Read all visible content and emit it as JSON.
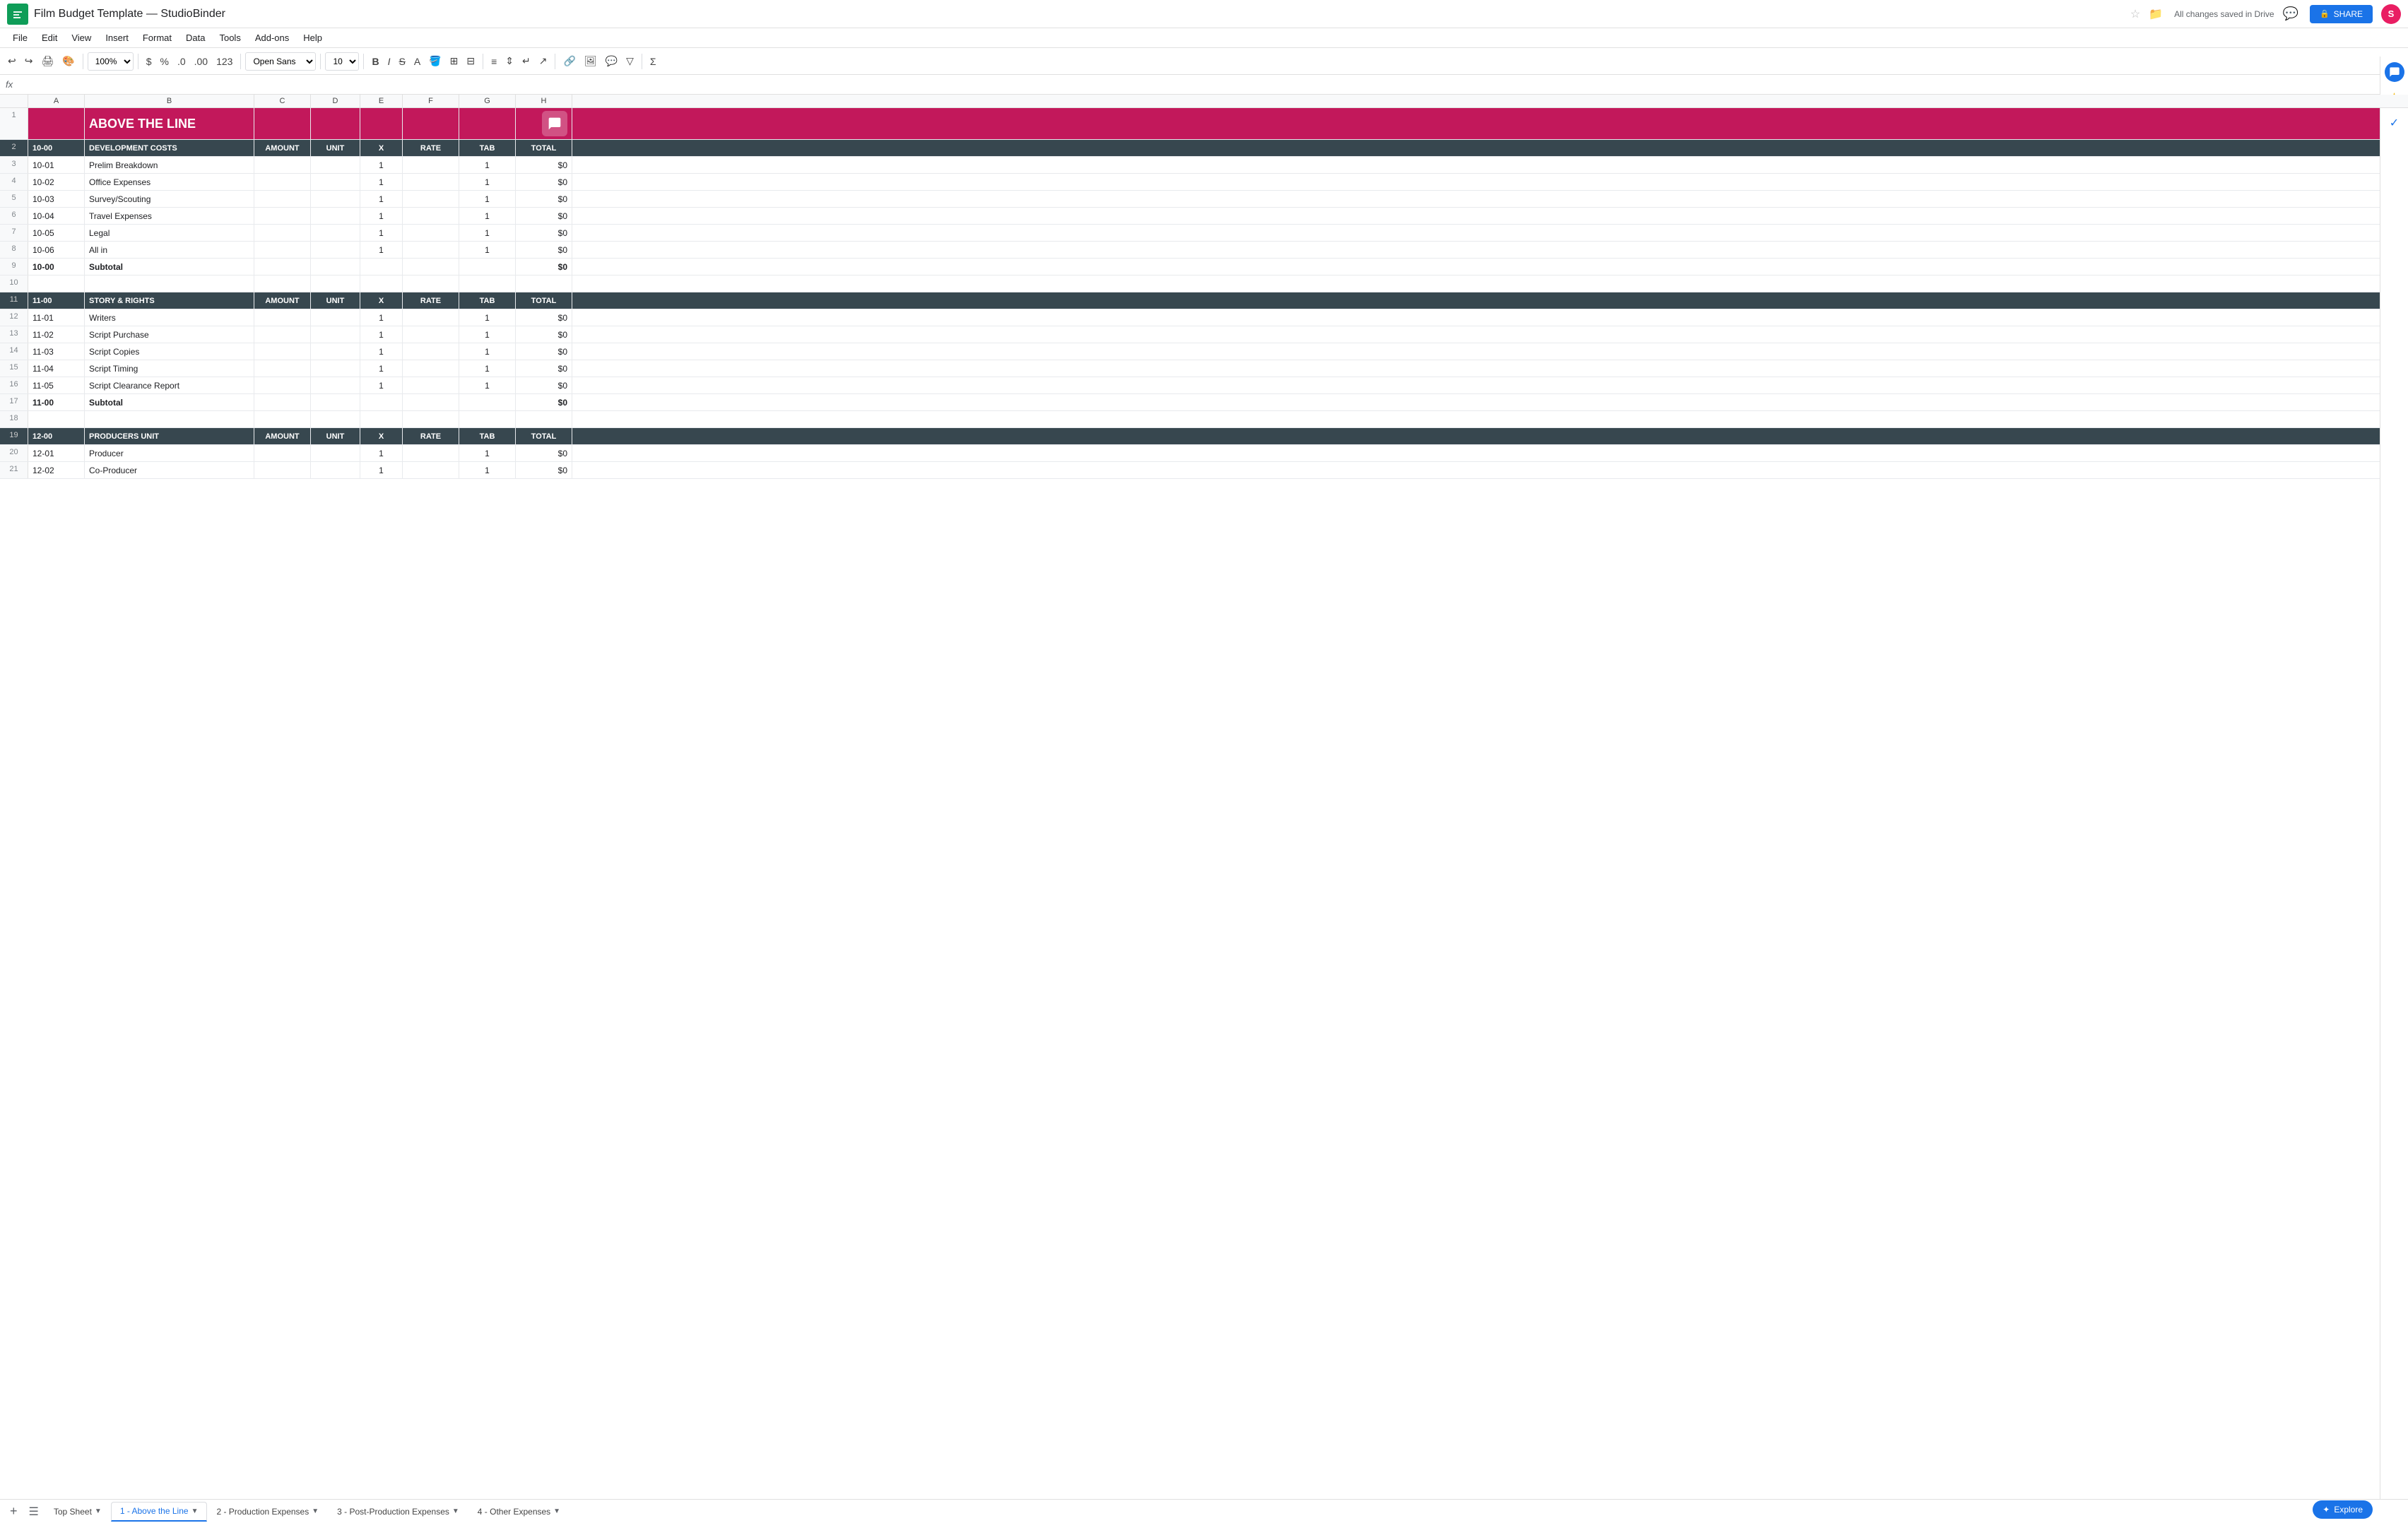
{
  "app": {
    "logo_letter": "S",
    "title": "Film Budget Template — StudioBinder",
    "saved_notice": "All changes saved in Drive"
  },
  "menubar": {
    "items": [
      "File",
      "Edit",
      "View",
      "Insert",
      "Format",
      "Data",
      "Tools",
      "Add-ons",
      "Help"
    ]
  },
  "toolbar": {
    "zoom": "100%",
    "font": "Open Sans",
    "font_size": "10"
  },
  "formulabar": {
    "fx": "fx"
  },
  "tabs": [
    {
      "label": "Top Sheet",
      "active": false
    },
    {
      "label": "1 - Above the Line",
      "active": true
    },
    {
      "label": "2 - Production Expenses",
      "active": false
    },
    {
      "label": "3 - Post-Production Expenses",
      "active": false
    },
    {
      "label": "4 - Other Expenses",
      "active": false
    }
  ],
  "col_headers": [
    "A",
    "B",
    "C",
    "D",
    "E",
    "F",
    "G",
    "H"
  ],
  "title_row": {
    "text": "ABOVE THE LINE",
    "bg": "#c2185b"
  },
  "sections": [
    {
      "row_num": 2,
      "code": "10-00",
      "name": "DEVELOPMENT COSTS",
      "cols": [
        "AMOUNT",
        "UNIT",
        "X",
        "RATE",
        "TAB",
        "TOTAL"
      ]
    },
    {
      "row_num": 11,
      "code": "11-00",
      "name": "STORY & RIGHTS",
      "cols": [
        "AMOUNT",
        "UNIT",
        "X",
        "RATE",
        "TAB",
        "TOTAL"
      ]
    },
    {
      "row_num": 19,
      "code": "12-00",
      "name": "PRODUCERS UNIT",
      "cols": [
        "AMOUNT",
        "UNIT",
        "X",
        "RATE",
        "TAB",
        "TOTAL"
      ]
    }
  ],
  "rows": [
    {
      "num": 1,
      "type": "title"
    },
    {
      "num": 2,
      "type": "section-header",
      "section": 0
    },
    {
      "num": 3,
      "type": "data",
      "code": "10-01",
      "name": "Prelim Breakdown",
      "amount": "",
      "unit": "",
      "x": "1",
      "rate": "",
      "tab": "1",
      "total": "$0"
    },
    {
      "num": 4,
      "type": "data",
      "code": "10-02",
      "name": "Office Expenses",
      "amount": "",
      "unit": "",
      "x": "1",
      "rate": "",
      "tab": "1",
      "total": "$0"
    },
    {
      "num": 5,
      "type": "data",
      "code": "10-03",
      "name": "Survey/Scouting",
      "amount": "",
      "unit": "",
      "x": "1",
      "rate": "",
      "tab": "1",
      "total": "$0"
    },
    {
      "num": 6,
      "type": "data",
      "code": "10-04",
      "name": "Travel Expenses",
      "amount": "",
      "unit": "",
      "x": "1",
      "rate": "",
      "tab": "1",
      "total": "$0"
    },
    {
      "num": 7,
      "type": "data",
      "code": "10-05",
      "name": "Legal",
      "amount": "",
      "unit": "",
      "x": "1",
      "rate": "",
      "tab": "1",
      "total": "$0"
    },
    {
      "num": 8,
      "type": "data",
      "code": "10-06",
      "name": "All in",
      "amount": "",
      "unit": "",
      "x": "1",
      "rate": "",
      "tab": "1",
      "total": "$0"
    },
    {
      "num": 9,
      "type": "subtotal",
      "code": "10-00",
      "name": "Subtotal",
      "total": "$0"
    },
    {
      "num": 10,
      "type": "empty"
    },
    {
      "num": 11,
      "type": "section-header",
      "section": 1
    },
    {
      "num": 12,
      "type": "data",
      "code": "11-01",
      "name": "Writers",
      "amount": "",
      "unit": "",
      "x": "1",
      "rate": "",
      "tab": "1",
      "total": "$0"
    },
    {
      "num": 13,
      "type": "data",
      "code": "11-02",
      "name": "Script Purchase",
      "amount": "",
      "unit": "",
      "x": "1",
      "rate": "",
      "tab": "1",
      "total": "$0"
    },
    {
      "num": 14,
      "type": "data",
      "code": "11-03",
      "name": "Script Copies",
      "amount": "",
      "unit": "",
      "x": "1",
      "rate": "",
      "tab": "1",
      "total": "$0"
    },
    {
      "num": 15,
      "type": "data",
      "code": "11-04",
      "name": "Script Timing",
      "amount": "",
      "unit": "",
      "x": "1",
      "rate": "",
      "tab": "1",
      "total": "$0"
    },
    {
      "num": 16,
      "type": "data",
      "code": "11-05",
      "name": "Script Clearance Report",
      "amount": "",
      "unit": "",
      "x": "1",
      "rate": "",
      "tab": "1",
      "total": "$0"
    },
    {
      "num": 17,
      "type": "subtotal",
      "code": "11-00",
      "name": "Subtotal",
      "total": "$0"
    },
    {
      "num": 18,
      "type": "empty"
    },
    {
      "num": 19,
      "type": "section-header",
      "section": 2
    },
    {
      "num": 20,
      "type": "data",
      "code": "12-01",
      "name": "Producer",
      "amount": "",
      "unit": "",
      "x": "1",
      "rate": "",
      "tab": "1",
      "total": "$0"
    },
    {
      "num": 21,
      "type": "data",
      "code": "12-02",
      "name": "Co-Producer",
      "amount": "",
      "unit": "",
      "x": "1",
      "rate": "",
      "tab": "1",
      "total": "$0"
    }
  ],
  "explore_btn": "Explore",
  "share_btn": "SHARE",
  "bottom_sheet_tabs": [
    "Top Sheet",
    "1 - Above the Line",
    "2 - Production Expenses",
    "3 - Post-Production Expenses",
    "4 - Other Expenses"
  ]
}
